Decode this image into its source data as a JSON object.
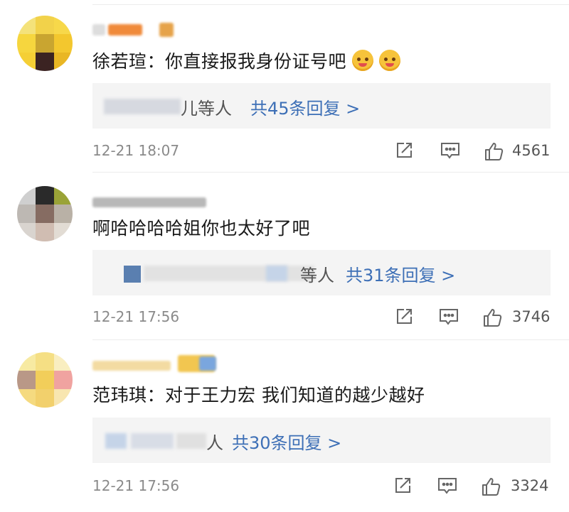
{
  "comments": [
    {
      "text": "徐若瑄：你直接报我身份证号吧",
      "emoji": [
        "smiling-face-with-hearts-emoji",
        "smiling-face-with-hearts-emoji"
      ],
      "reply_names": "儿等人",
      "reply_link": "共45条回复 >",
      "time": "12-21 18:07",
      "likes": "4561"
    },
    {
      "text": "啊哈哈哈哈姐你也太好了吧",
      "reply_names": "等人",
      "reply_link": "共31条回复 >",
      "time": "12-21 17:56",
      "likes": "3746"
    },
    {
      "text": "范玮琪：对于王力宏 我们知道的越少越好",
      "reply_names": "人",
      "reply_link": "共30条回复 >",
      "time": "12-21 17:56",
      "likes": "3324"
    }
  ],
  "colors": {
    "link": "#3d6fb6",
    "meta": "#8a8a8a",
    "reply_bg": "#f4f4f4"
  },
  "icons": [
    "share-icon",
    "comment-icon",
    "like-icon"
  ]
}
